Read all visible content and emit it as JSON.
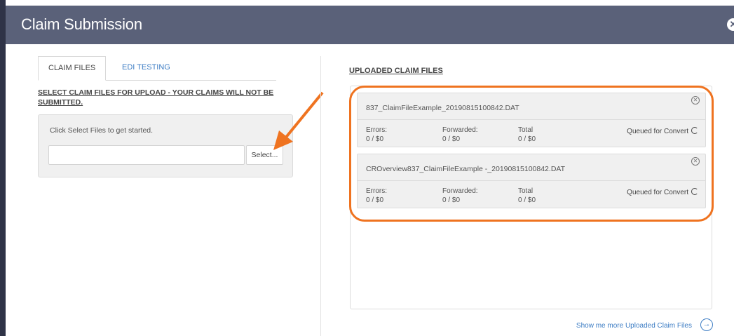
{
  "header": {
    "title": "Claim Submission",
    "close_symbol": "✕"
  },
  "tabs": [
    {
      "label": "CLAIM FILES",
      "active": true
    },
    {
      "label": "EDI TESTING",
      "active": false
    }
  ],
  "left": {
    "notice": "SELECT CLAIM FILES FOR UPLOAD - YOUR CLAIMS WILL NOT BE SUBMITTED.",
    "hint": "Click Select Files to get started.",
    "file_input_value": "",
    "select_label": "Select..."
  },
  "right": {
    "title": "UPLOADED CLAIM FILES",
    "files": [
      {
        "name": "837_ClaimFileExample_20190815100842.DAT",
        "errors_label": "Errors:",
        "errors_value": "0 / $0",
        "forwarded_label": "Forwarded:",
        "forwarded_value": "0 / $0",
        "total_label": "Total",
        "total_value": "0 / $0",
        "status": "Queued for Convert"
      },
      {
        "name": "CROverview837_ClaimFileExample -_20190815100842.DAT",
        "errors_label": "Errors:",
        "errors_value": "0 / $0",
        "forwarded_label": "Forwarded:",
        "forwarded_value": "0 / $0",
        "total_label": "Total",
        "total_value": "0 / $0",
        "status": "Queued for Convert"
      }
    ],
    "more_link": "Show me more Uploaded Claim Files"
  },
  "colors": {
    "header": "#5a6179",
    "accent": "#3d7dc4",
    "highlight": "#ef7320"
  },
  "icons": {
    "close": "close-icon",
    "remove": "remove-circle-icon",
    "spinner": "spinner-icon",
    "arrow": "arrow-right-circle-icon"
  }
}
